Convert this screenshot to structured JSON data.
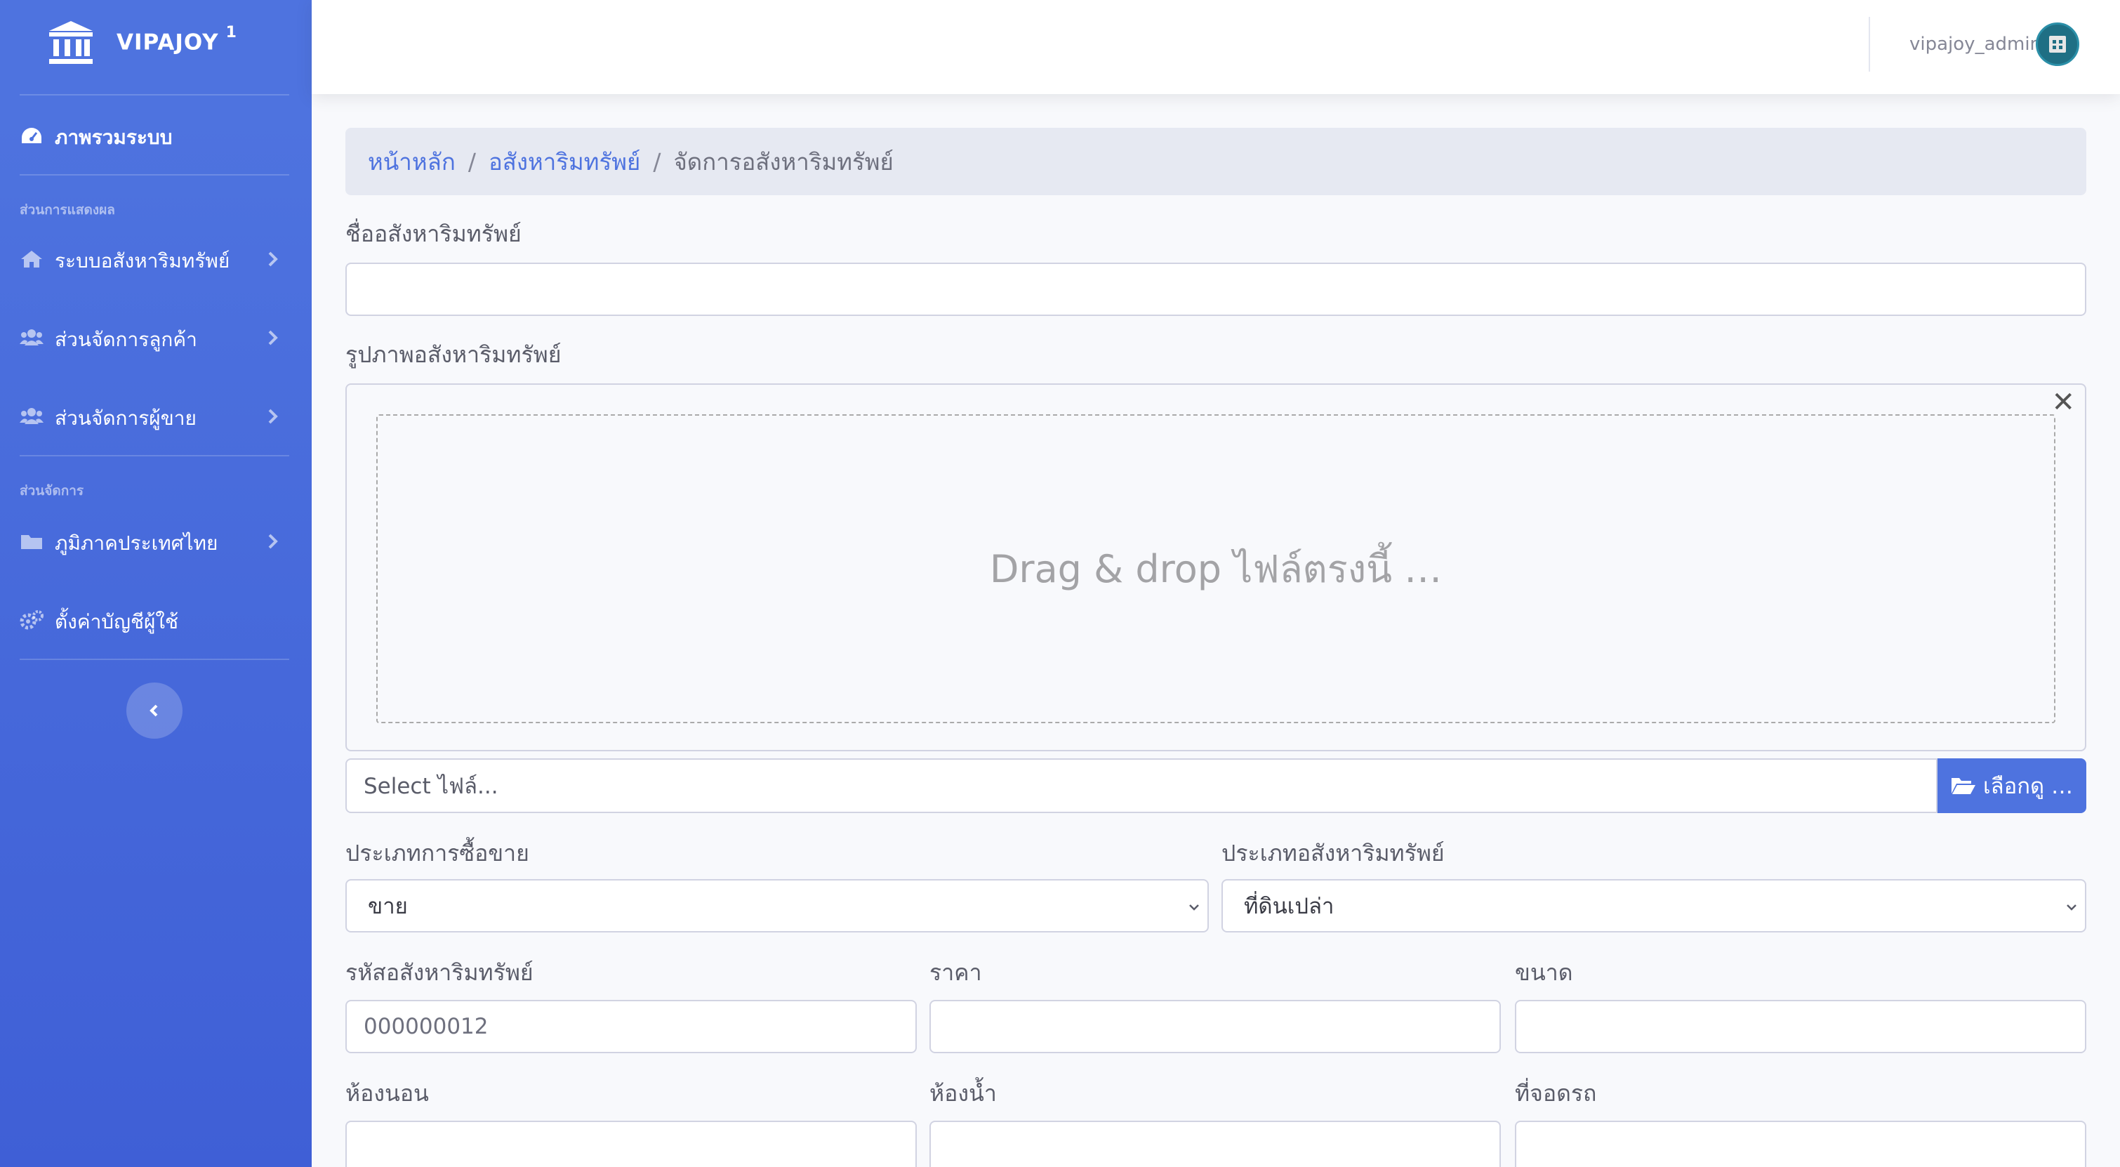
{
  "sidebar": {
    "brand": {
      "name": "VIPAJOY",
      "badge": "1"
    },
    "overview": "ภาพรวมระบบ",
    "section_display": "ส่วนการแสดงผล",
    "items_display": [
      {
        "label": "ระบบอสังหาริมทรัพย์",
        "icon": "home-icon"
      },
      {
        "label": "ส่วนจัดการลูกค้า",
        "icon": "users-icon"
      },
      {
        "label": "ส่วนจัดการผู้ขาย",
        "icon": "users-icon"
      }
    ],
    "section_manage": "ส่วนจัดการ",
    "items_manage": [
      {
        "label": "ภูมิภาคประเทศไทย",
        "icon": "folder-icon"
      },
      {
        "label": "ตั้งค่าบัญชีผู้ใช้",
        "icon": "cogs-icon"
      }
    ]
  },
  "topbar": {
    "username": "vipajoy_admin"
  },
  "breadcrumb": {
    "home": "หน้าหลัก",
    "section": "อสังหาริมทรัพย์",
    "current": "จัดการอสังหาริมทรัพย์"
  },
  "form": {
    "name_label": "ชื่ออสังหาริมทรัพย์",
    "name_value": "",
    "image_label": "รูปภาพอสังหาริมทรัพย์",
    "dropzone_text": "Drag & drop ไฟล์ตรงนี้ …",
    "file_placeholder": "Select ไฟล์...",
    "browse_label": "เลือกดู …",
    "sale_type_label": "ประเภทการซื้อขาย",
    "sale_type_value": "ขาย",
    "property_type_label": "ประเภทอสังหาริมทรัพย์",
    "property_type_value": "ที่ดินเปล่า",
    "code_label": "รหัสอสังหาริมทรัพย์",
    "code_value": "000000012",
    "price_label": "ราคา",
    "price_value": "",
    "size_label": "ขนาด",
    "size_value": "",
    "bedroom_label": "ห้องนอน",
    "bedroom_value": "",
    "bathroom_label": "ห้องน้ำ",
    "bathroom_value": "",
    "parking_label": "ที่จอดรถ",
    "parking_value": ""
  },
  "colors": {
    "sidebar": "#4e73df",
    "accent": "#4e73df"
  }
}
